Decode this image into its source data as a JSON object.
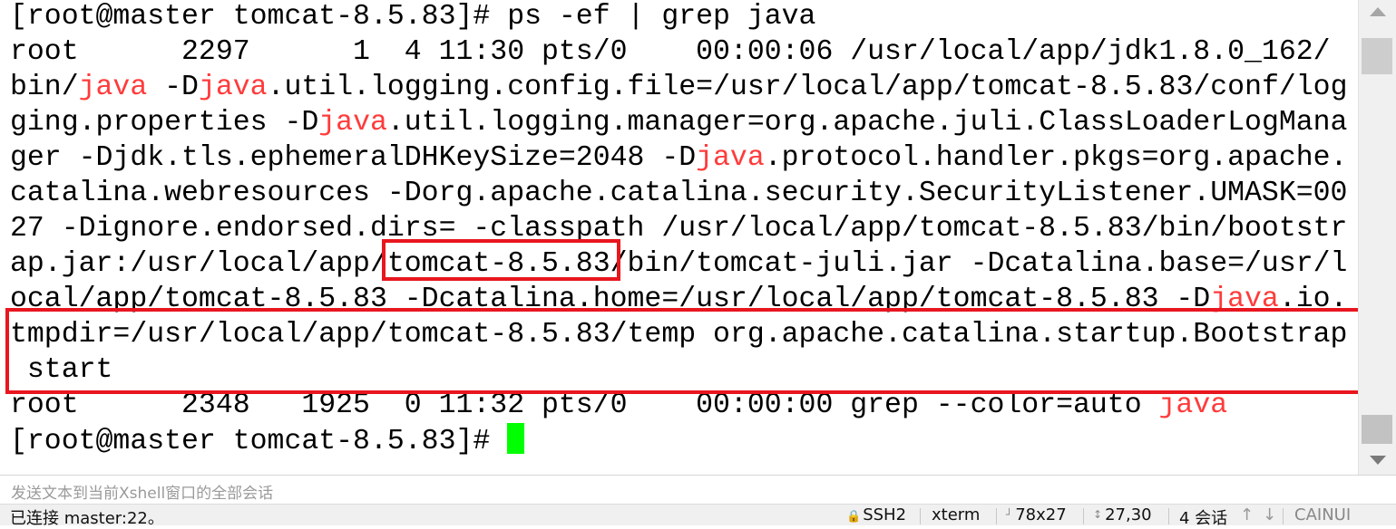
{
  "terminal": {
    "lines": [
      [
        {
          "t": "[root@master tomcat-8.5.83]# ps -ef | grep java"
        }
      ],
      [
        {
          "t": "root      2297      1  4 11:30 pts/0    00:00:06 /usr/local/app/jdk1.8.0_162/"
        }
      ],
      [
        {
          "t": "bin/"
        },
        {
          "t": "java",
          "h": true
        },
        {
          "t": " -D"
        },
        {
          "t": "java",
          "h": true
        },
        {
          "t": ".util.logging.config.file=/usr/local/app/tomcat-8.5.83/conf/log"
        }
      ],
      [
        {
          "t": "ging.properties -D"
        },
        {
          "t": "java",
          "h": true
        },
        {
          "t": ".util.logging.manager=org.apache.juli.ClassLoaderLogMana"
        }
      ],
      [
        {
          "t": "ger -Djdk.tls.ephemeralDHKeySize=2048 -D"
        },
        {
          "t": "java",
          "h": true
        },
        {
          "t": ".protocol.handler.pkgs=org.apache."
        }
      ],
      [
        {
          "t": "catalina.webresources -Dorg.apache.catalina.security.SecurityListener.UMASK=00"
        }
      ],
      [
        {
          "t": "27 -Dignore.endorsed.dirs= -classpath /usr/local/app/tomcat-8.5.83/bin/bootstr"
        }
      ],
      [
        {
          "t": "ap.jar:/usr/local/app/tomcat-8.5.83/bin/tomcat-juli.jar -Dcatalina.base=/usr/l"
        }
      ],
      [
        {
          "t": "ocal/app/tomcat-8.5.83 -Dcatalina.home=/usr/local/app/tomcat-8.5.83 -D"
        },
        {
          "t": "java",
          "h": true
        },
        {
          "t": ".io."
        }
      ],
      [
        {
          "t": "tmpdir=/usr/local/app/tomcat-8.5.83/temp org.apache.catalina.startup.Bootstrap"
        }
      ],
      [
        {
          "t": " start"
        }
      ],
      [
        {
          "t": "root      2348   1925  0 11:32 pts/0    00:00:00 grep --color=auto "
        },
        {
          "t": "java",
          "h": true
        }
      ],
      [
        {
          "t": "[root@master tomcat-8.5.83]# "
        }
      ]
    ],
    "highlight_color": "#ff3b3b",
    "annotation_color": "#e8161f",
    "cursor_color": "#00ff00"
  },
  "composer": {
    "placeholder": "发送文本到当前Xshell窗口的全部会话"
  },
  "status": {
    "connection": "已连接 master:22。",
    "protocol": "SSH2",
    "terminal_type": "xterm",
    "size": "78x27",
    "cursor_pos": "27,30",
    "sessions": "4 会话",
    "caps": "CAINUI"
  }
}
